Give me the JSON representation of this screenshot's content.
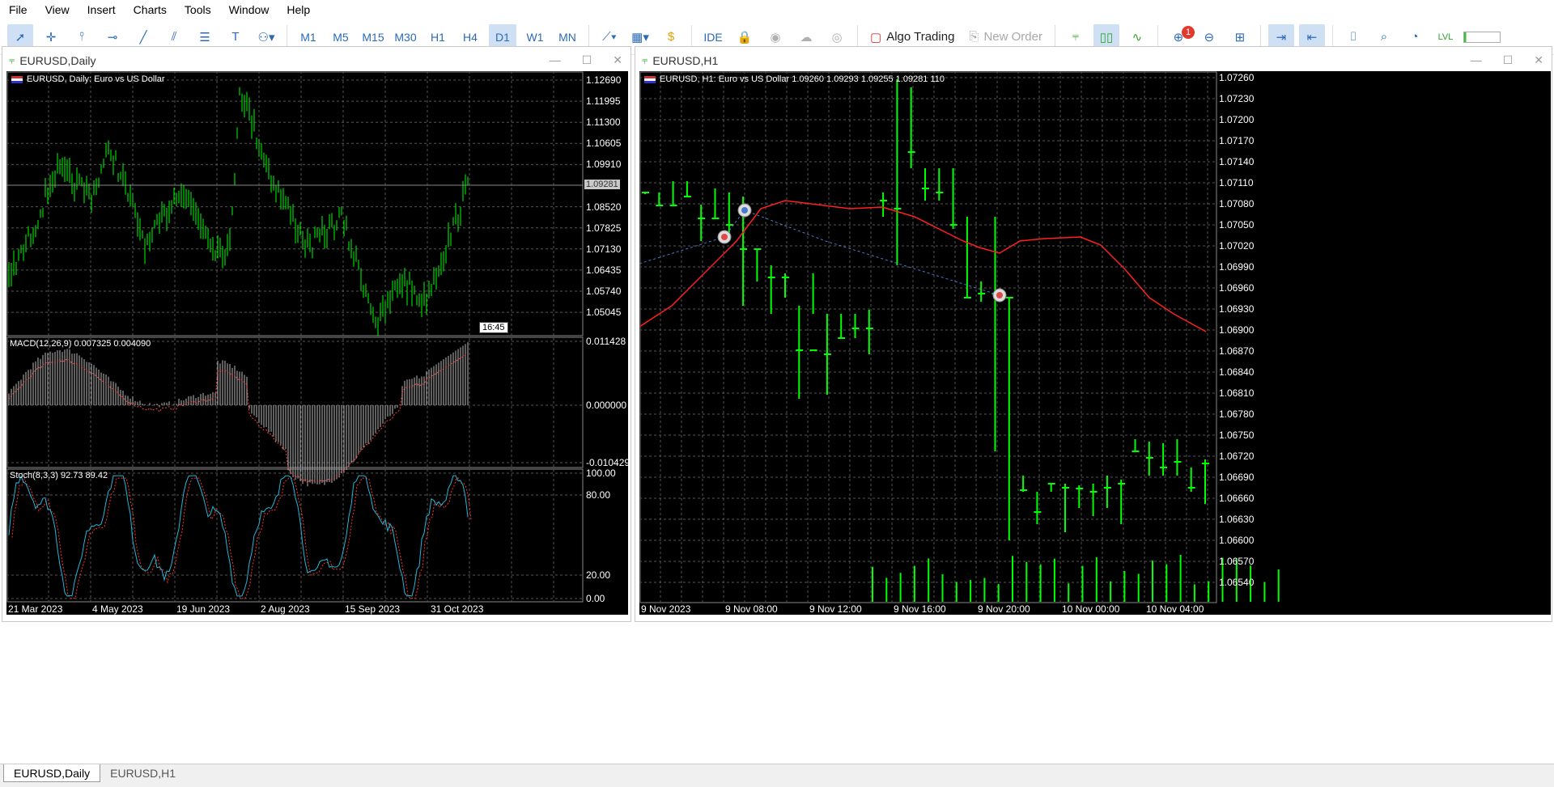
{
  "menu": [
    "File",
    "View",
    "Insert",
    "Charts",
    "Tools",
    "Window",
    "Help"
  ],
  "toolbar": {
    "periods": [
      "M1",
      "M5",
      "M15",
      "M30",
      "H1",
      "H4",
      "D1",
      "W1",
      "MN"
    ],
    "active_period": "D1",
    "ide_label": "IDE",
    "algo_trading_label": "Algo Trading",
    "new_order_label": "New Order",
    "notification_count": "1"
  },
  "windows": {
    "daily": {
      "title": "EURUSD,Daily",
      "header": "EURUSD, Daily:  Euro vs US Dollar",
      "price_tag": "1.09281",
      "time_tag": "16:45",
      "price_ticks": [
        "1.12690",
        "1.11995",
        "1.11300",
        "1.10605",
        "1.09910",
        "1.08520",
        "1.07825",
        "1.07130",
        "1.06435",
        "1.05740",
        "1.05045"
      ],
      "macd_label": "MACD(12,26,9) 0.007325 0.004090",
      "macd_ticks": [
        "0.011428",
        "0.000000",
        "-0.010429"
      ],
      "stoch_label": "Stoch(8,3,3) 92.73 89.42",
      "stoch_ticks": [
        "100.00",
        "80.00",
        "20.00",
        "0.00"
      ],
      "date_ticks": [
        "21 Mar 2023",
        "4 May 2023",
        "19 Jun 2023",
        "2 Aug 2023",
        "15 Sep 2023",
        "31 Oct 2023"
      ]
    },
    "h1": {
      "title": "EURUSD,H1",
      "header": "EURUSD, H1:  Euro vs US Dollar  1.09260 1.09293 1.09255 1.09281  110",
      "price_ticks": [
        "1.07260",
        "1.07230",
        "1.07200",
        "1.07170",
        "1.07140",
        "1.07110",
        "1.07080",
        "1.07050",
        "1.07020",
        "1.06990",
        "1.06960",
        "1.06930",
        "1.06900",
        "1.06870",
        "1.06840",
        "1.06810",
        "1.06780",
        "1.06750",
        "1.06720",
        "1.06690",
        "1.06660",
        "1.06630",
        "1.06600",
        "1.06570",
        "1.06540"
      ],
      "date_ticks": [
        "9 Nov 2023",
        "9 Nov 08:00",
        "9 Nov 12:00",
        "9 Nov 16:00",
        "9 Nov 20:00",
        "10 Nov 00:00",
        "10 Nov 04:00"
      ]
    }
  },
  "tabs": [
    "EURUSD,Daily",
    "EURUSD,H1"
  ],
  "active_tab": "EURUSD,Daily",
  "colors": {
    "bars": "#00ff00",
    "ma_line": "#ff2020",
    "macd_signal": "#ff4040",
    "stoch_main": "#22b8d8",
    "stoch_signal": "#ff3030",
    "grid": "#555555"
  }
}
